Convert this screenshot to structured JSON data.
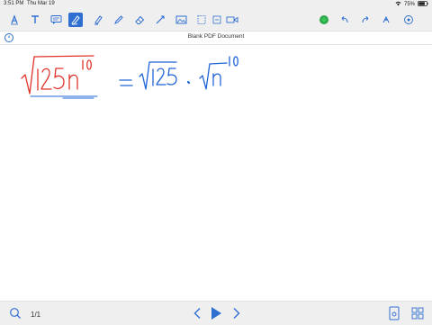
{
  "status": {
    "time": "3:51 PM",
    "date": "Thu Mar 19",
    "battery": "75%"
  },
  "document": {
    "title": "Blank PDF Document"
  },
  "page_indicator": "1/1",
  "colors": {
    "accent": "#2e6fd1",
    "ink_red": "#e0332b",
    "ink_blue": "#1f63d8",
    "record_green": "#2ea84a"
  },
  "toolbar": {
    "left_tools": [
      "pen-tool-icon",
      "text-tool-icon",
      "comment-icon",
      "freehand-icon",
      "highlighter-icon",
      "eraser-icon",
      "line-icon",
      "shape-icon",
      "image-icon",
      "insert-icon",
      "video-icon"
    ],
    "active_tool": "freehand-icon",
    "right_tools": [
      "record-button-icon",
      "back-icon",
      "forward-icon",
      "share-icon",
      "more-icon"
    ]
  },
  "handwriting": {
    "left": {
      "text": "√125n¹⁰",
      "color": "red"
    },
    "right": {
      "text": "= √125 · √n¹⁰",
      "color": "blue"
    }
  }
}
